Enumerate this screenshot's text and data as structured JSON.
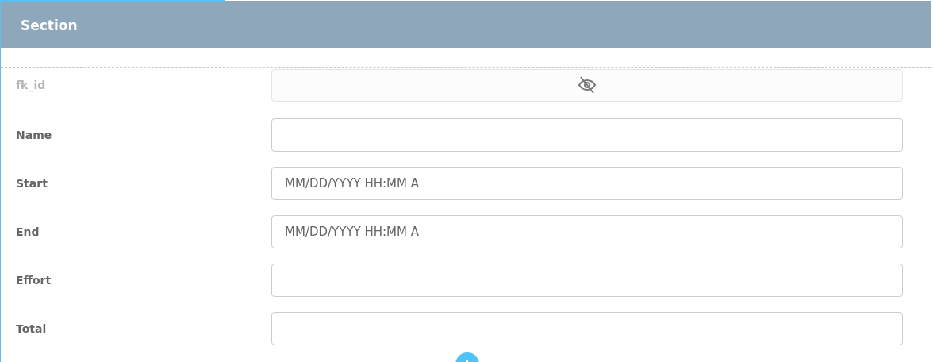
{
  "section": {
    "title": "Section"
  },
  "fields": [
    {
      "label": "fk_id",
      "kind": "hidden"
    },
    {
      "label": "Name",
      "kind": "text"
    },
    {
      "label": "Start",
      "kind": "text",
      "placeholder": "MM/DD/YYYY HH:MM A"
    },
    {
      "label": "End",
      "kind": "text",
      "placeholder": "MM/DD/YYYY HH:MM A"
    },
    {
      "label": "Effort",
      "kind": "text"
    },
    {
      "label": "Total",
      "kind": "text"
    }
  ]
}
